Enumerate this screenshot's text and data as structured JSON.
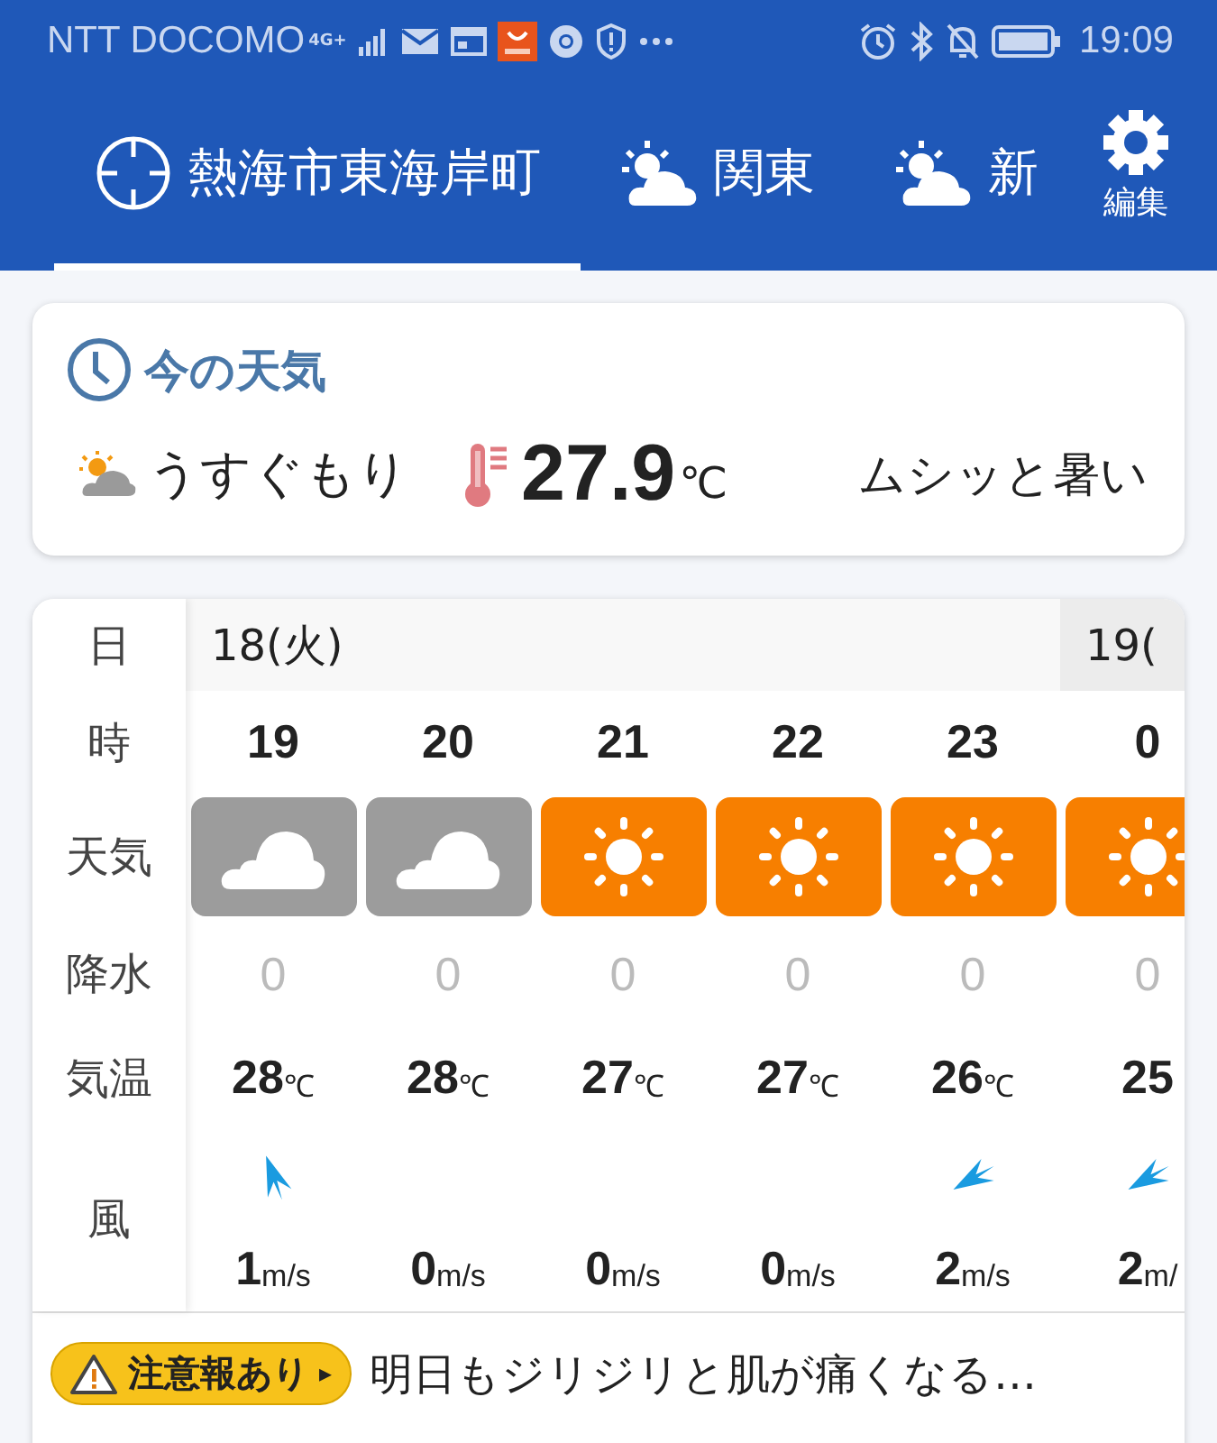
{
  "status_bar": {
    "carrier": "NTT DOCOMO",
    "network": "4G+",
    "time": "19:09"
  },
  "tabs": [
    {
      "label": "熱海市東海岸町",
      "kind": "location",
      "selected": true
    },
    {
      "label": "関東",
      "kind": "partly-cloudy",
      "selected": false
    },
    {
      "label": "新",
      "kind": "partly-cloudy",
      "selected": false
    }
  ],
  "edit_button": {
    "label": "編集"
  },
  "current": {
    "title": "今の天気",
    "condition": "うすぐもり",
    "temperature": "27.9",
    "unit": "℃",
    "feeling": "ムシッと暑い"
  },
  "row_labels": {
    "date": "日",
    "time": "時",
    "weather": "天気",
    "precipitation": "降水",
    "temperature": "気温",
    "wind": "風"
  },
  "days": [
    {
      "date": "18(火)",
      "hours": [
        {
          "time": "19",
          "kind": "cloudy",
          "precipitation": "0",
          "temperature": "28",
          "temp_unit": "℃",
          "wind_arrow": {
            "kind": "up"
          },
          "wind_speed": "1",
          "wind_unit": "m/s"
        },
        {
          "time": "20",
          "kind": "cloudy",
          "precipitation": "0",
          "temperature": "28",
          "temp_unit": "℃",
          "wind_speed": "0",
          "wind_unit": "m/s"
        },
        {
          "time": "21",
          "kind": "sunny",
          "precipitation": "0",
          "temperature": "27",
          "temp_unit": "℃",
          "wind_speed": "0",
          "wind_unit": "m/s"
        },
        {
          "time": "22",
          "kind": "sunny",
          "precipitation": "0",
          "temperature": "27",
          "temp_unit": "℃",
          "wind_speed": "0",
          "wind_unit": "m/s"
        },
        {
          "time": "23",
          "kind": "sunny",
          "precipitation": "0",
          "temperature": "26",
          "temp_unit": "℃",
          "wind_arrow": {
            "kind": "down-left"
          },
          "wind_speed": "2",
          "wind_unit": "m/s"
        }
      ]
    },
    {
      "date": "19(",
      "hours": [
        {
          "time": "0",
          "kind": "sunny",
          "precipitation": "0",
          "temperature": "25",
          "wind_arrow": {
            "kind": "down-left"
          },
          "wind_speed": "2",
          "wind_unit": "m/"
        }
      ]
    }
  ],
  "alert": {
    "badge": "注意報あり",
    "caret": "▸",
    "message": "明日もジリジリと肌が痛くなる…"
  }
}
